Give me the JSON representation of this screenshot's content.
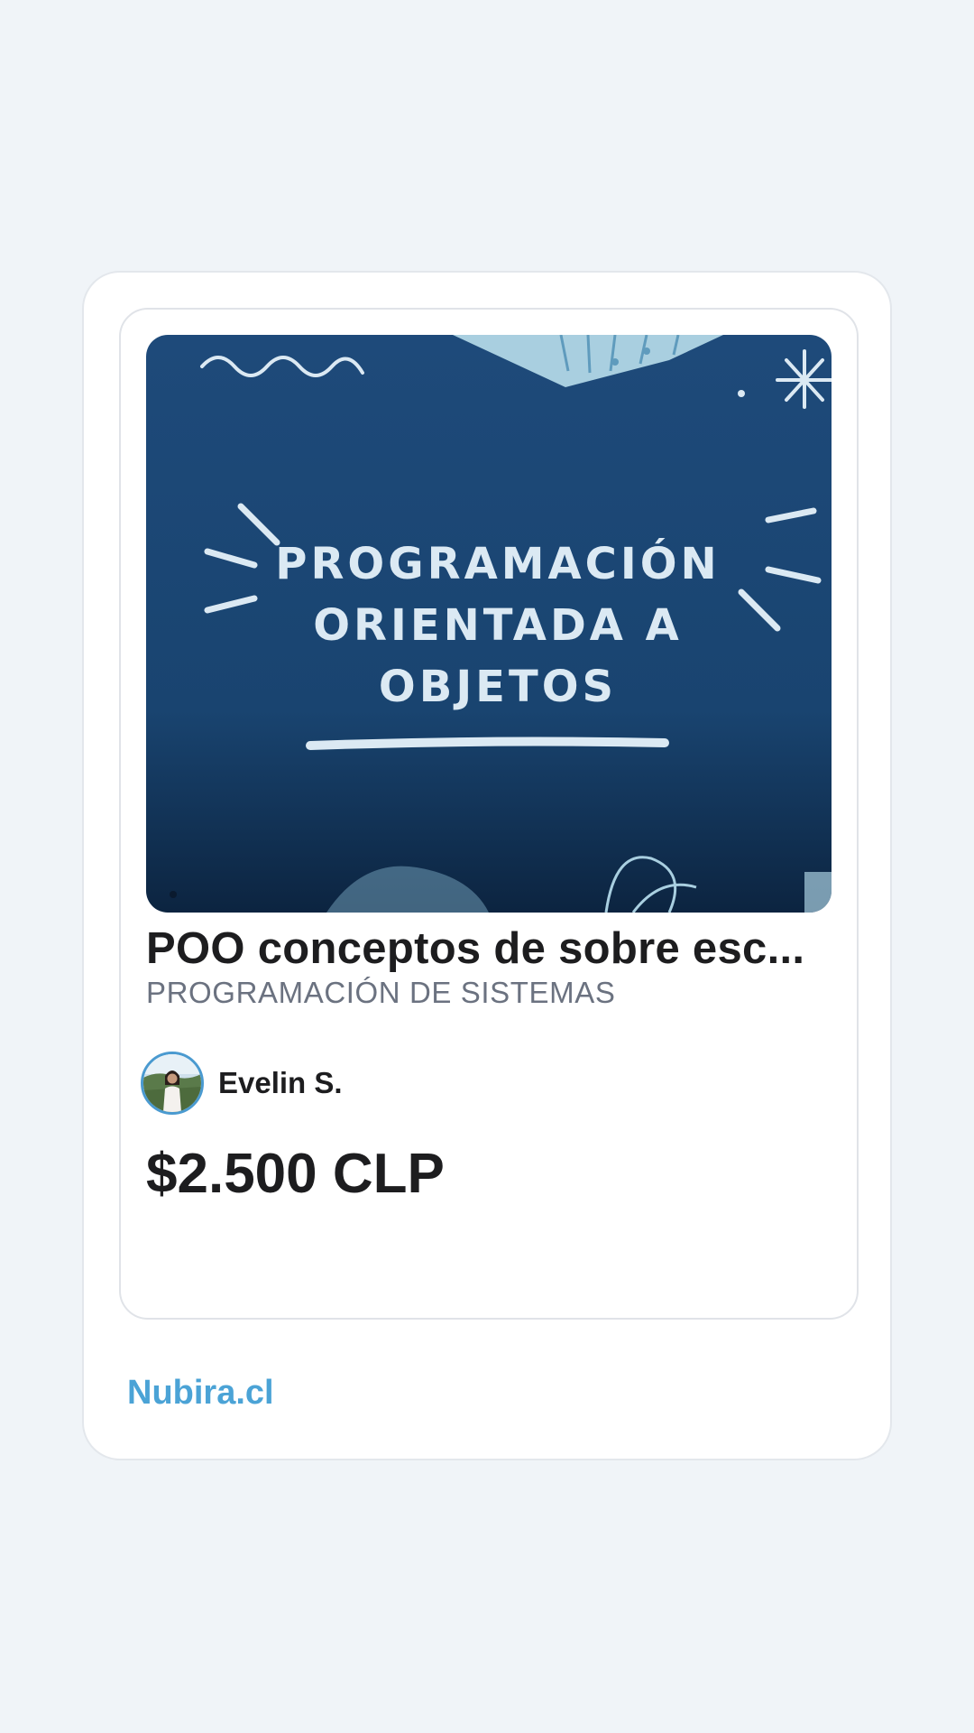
{
  "product": {
    "image_text": [
      "PROGRAMACIÓN",
      "ORIENTADA A",
      "OBJETOS"
    ],
    "title": "POO conceptos de sobre esc...",
    "category": "PROGRAMACIÓN DE SISTEMAS",
    "seller_name": "Evelin S.",
    "price": "$2.500 CLP"
  },
  "footer": {
    "brand": "Nubira.cl"
  },
  "colors": {
    "background": "#f0f4f8",
    "thumbnail_bg": "#1b4573",
    "thumbnail_text": "#dbe9f3",
    "brand": "#4ba3d6",
    "avatar_ring": "#4a9ad0"
  }
}
